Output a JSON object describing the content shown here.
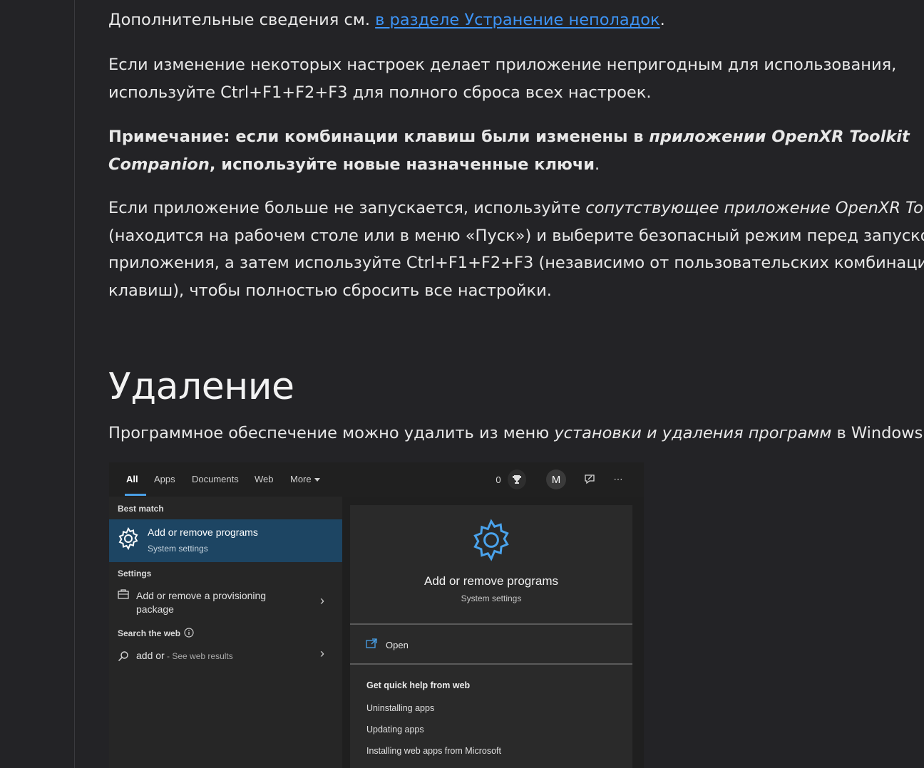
{
  "article": {
    "p1_text": "Дополнительные сведения см. ",
    "p1_link": "в разделе Устранение неполадок",
    "p1_end": ".",
    "p2_line1": "Если изменение некоторых настроек делает приложение непригодным для использования,",
    "p2_line2": "используйте Ctrl+F1+F2+F3 для полного сброса всех настроек.",
    "note_bold1": "Примечание: если комбинации клавиш были изменены в ",
    "note_italic1": "приложении OpenXR Toolkit",
    "note_italic2": "Companion",
    "note_bold2": ", используйте новые назначенные ключи",
    "note_end": ".",
    "p4_start": "Если приложение больше не запускается, используйте ",
    "p4_italic": "сопутствующее приложение OpenXR Toolkit",
    "p4_line2": "(находится на рабочем столе или в меню «Пуск») и выберите безопасный режим перед запуском",
    "p4_line3": "приложения, а затем используйте Ctrl+F1+F2+F3 (независимо от пользовательских комбинаций",
    "p4_line4": "клавиш), чтобы полностью сбросить все настройки.",
    "section_title": "Удаление",
    "p5_start": "Программное обеспечение можно удалить из меню ",
    "p5_italic": "установки и удаления программ",
    "p5_end": " в Windows."
  },
  "screenshot": {
    "tabs": [
      "All",
      "Apps",
      "Documents",
      "Web",
      "More"
    ],
    "points": "0",
    "avatar_letter": "M",
    "more_icon": "⋯",
    "best_match_label": "Best match",
    "best_match_title": "Add or remove programs",
    "best_match_sub": "System settings",
    "settings_label": "Settings",
    "settings_item_line1": "Add or remove a provisioning",
    "settings_item_line2": "package",
    "search_web_label": "Search the web",
    "web_query": "add or",
    "web_suffix": " - See web results",
    "preview_title": "Add or remove programs",
    "preview_sub": "System settings",
    "open_label": "Open",
    "help_title": "Get quick help from web",
    "help_links": [
      "Uninstalling apps",
      "Updating apps",
      "Installing web apps from Microsoft"
    ],
    "accent_color": "#1d4563"
  }
}
